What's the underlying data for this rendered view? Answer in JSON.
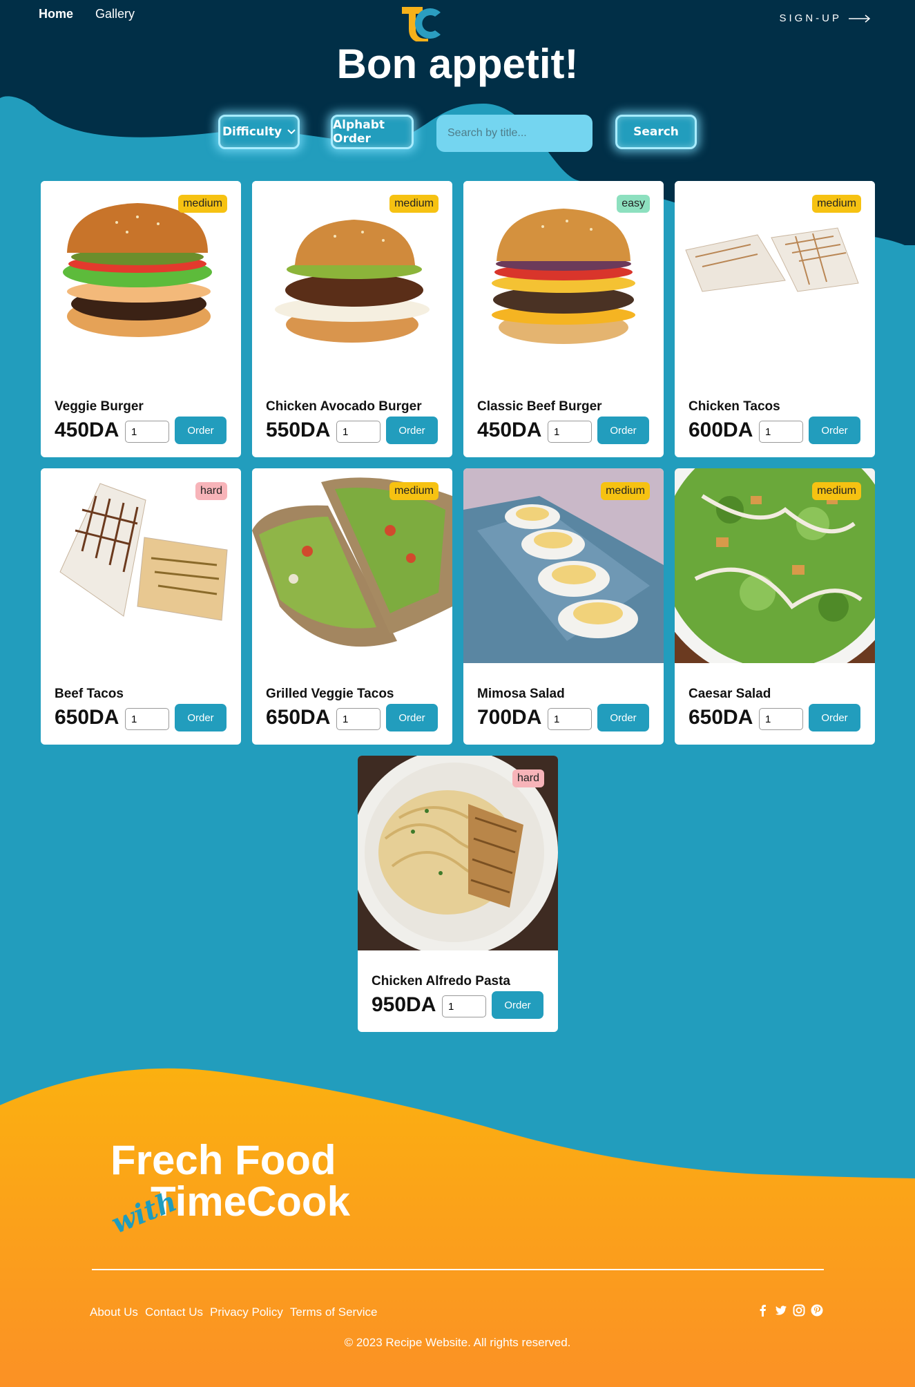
{
  "nav": {
    "home": "Home",
    "gallery": "Gallery",
    "signup": "SIGN-UP"
  },
  "title": "Bon appetit!",
  "controls": {
    "difficulty": "Difficulty",
    "alphabet": "Alphabt Order",
    "search_placeholder": "Search by title...",
    "search": "Search"
  },
  "recipes": [
    {
      "name": "Veggie Burger",
      "price": "450DA",
      "difficulty": "medium",
      "qty": "1",
      "order": "Order",
      "photo": "veggie-burger"
    },
    {
      "name": "Chicken Avocado Burger",
      "price": "550DA",
      "difficulty": "medium",
      "qty": "1",
      "order": "Order",
      "photo": "chicken-avocado-burger"
    },
    {
      "name": "Classic Beef Burger",
      "price": "450DA",
      "difficulty": "easy",
      "qty": "1",
      "order": "Order",
      "photo": "classic-beef-burger"
    },
    {
      "name": "Chicken Tacos",
      "price": "600DA",
      "difficulty": "medium",
      "qty": "1",
      "order": "Order",
      "photo": "chicken-tacos"
    },
    {
      "name": "Beef Tacos",
      "price": "650DA",
      "difficulty": "hard",
      "qty": "1",
      "order": "Order",
      "photo": "beef-tacos"
    },
    {
      "name": "Grilled Veggie Tacos",
      "price": "650DA",
      "difficulty": "medium",
      "qty": "1",
      "order": "Order",
      "photo": "grilled-veggie-tacos"
    },
    {
      "name": "Mimosa Salad",
      "price": "700DA",
      "difficulty": "medium",
      "qty": "1",
      "order": "Order",
      "photo": "mimosa-salad"
    },
    {
      "name": "Caesar Salad",
      "price": "650DA",
      "difficulty": "medium",
      "qty": "1",
      "order": "Order",
      "photo": "caesar-salad"
    },
    {
      "name": "Chicken Alfredo Pasta",
      "price": "950DA",
      "difficulty": "hard",
      "qty": "1",
      "order": "Order",
      "photo": "chicken-alfredo-pasta"
    }
  ],
  "brand": {
    "line1": "Frech Food",
    "with": "with",
    "line2": "TimeCook"
  },
  "footer": {
    "links": [
      "About Us",
      "Contact Us",
      "Privacy Policy",
      "Terms of Service"
    ],
    "social_icons": [
      "facebook-icon",
      "twitter-icon",
      "instagram-icon",
      "pinterest-icon"
    ],
    "copyright": "© 2023 Recipe Website. All rights reserved."
  },
  "colors": {
    "navy": "#012f47",
    "teal": "#229dbd",
    "accent_orange": "#fbae17",
    "badge_medium": "#f6c212",
    "badge_easy": "#8de0bf",
    "badge_hard": "#f7b4b9"
  }
}
